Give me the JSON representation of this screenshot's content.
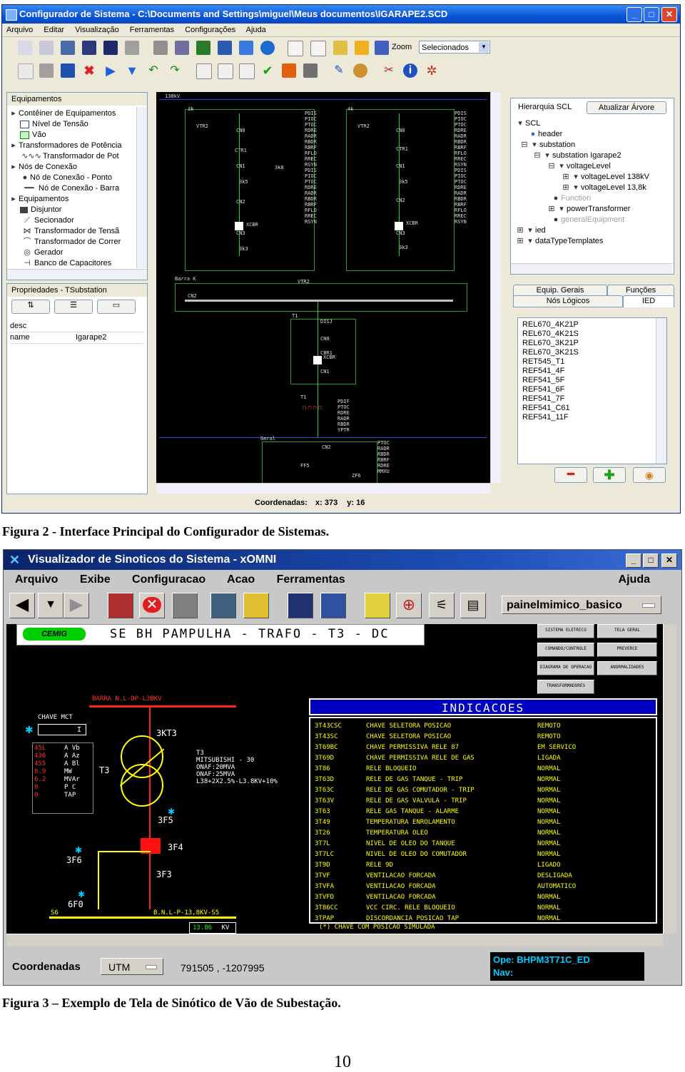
{
  "fig2": {
    "title": "Configurador de Sistema - C:\\Documents and Settings\\miguel\\Meus documentos\\IGARAPE2.SCD",
    "menu": [
      "Arquivo",
      "Editar",
      "Visualização",
      "Ferramentas",
      "Configurações",
      "Ajuda"
    ],
    "zoom_label": "Zoom",
    "zoom_select": "Selecionados",
    "equipamentos": {
      "header": "Equipamentos",
      "items": [
        "Contêiner de Equipamentos",
        "Nível de Tensão",
        "Vão",
        "Transformadores de Potência",
        "Transformador de Pot",
        "Nós de Conexão",
        "Nó de Conexão - Ponto",
        "Nó de Conexão - Barra",
        "Equipamentos",
        "Disjuntor",
        "Secionador",
        "Transformador de Tensã",
        "Transformador de Correr",
        "Gerador",
        "Banco de Capacitores"
      ]
    },
    "propriedades": {
      "header": "Propriedades - TSubstation",
      "rows": [
        {
          "key": "desc",
          "value": ""
        },
        {
          "key": "name",
          "value": "Igarape2"
        }
      ]
    },
    "diagram": {
      "bus_label": "138kV",
      "bay_left": {
        "label": "3k",
        "vt": "VTR2",
        "cb": "XCBR",
        "nodes": [
          "CN0",
          "CN1",
          "CN2",
          "CN3"
        ],
        "ctr": "CTR1",
        "sw": [
          "3k5",
          "3k8",
          "3k3",
          "3k4"
        ],
        "lns": "PDIS\nPIOC\nPTOC\nRDRE\nRADR\nRBDR\nRBRF\nRFLO\nRREC\nRSYN\nPDIS\nPIOC\nPTOC\nRDRE\nRADR\nRBDR\nRBRF\nRFLO\nRREC\nRSYN"
      },
      "bay_right": {
        "label": "4k",
        "vt": "VTR2",
        "cb": "XCBR",
        "nodes": [
          "CN0",
          "CN1",
          "CN2",
          "CN3"
        ],
        "ctr": "CTR1",
        "sw": [
          "3k5",
          "3k3"
        ],
        "lns": "PDIS\nPIOC\nPTOC\nRDRE\nRADR\nRBDR\nRBRF\nRFLO\nRREC\nRSYN\nPDIS\nPIOC\nPTOC\nRDRE\nRADR\nRBDR\nRBRF\nRFLO\nRREC\nRSYN"
      },
      "barra_label": "Barra K",
      "barra_cn": "CN2",
      "barra_vt": "VTR2",
      "t1_label": "T1",
      "t1_nodes": [
        "DISJ",
        "CN0",
        "CBR1",
        "XCBR",
        "CN1"
      ],
      "t1_lns": "PDIF\nPTOC\nRDRE\nRADR\nRBDR\nYPTR",
      "geral_label": "Geral",
      "geral_cn": "CN2",
      "geral_lns": "PTOC\nRADR\nRBDR\nRBRF\nRDRE\nMMXU",
      "geral_sw": [
        "FF5",
        "ZF6"
      ],
      "coords_label": "Coordenadas:",
      "coord_x": "x: 373",
      "coord_y": "y: 16"
    },
    "hierarquia": {
      "header": "Hierarquia SCL",
      "button": "Atualizar Árvore",
      "tree": [
        "SCL",
        "header",
        "substation",
        "substation Igarape2",
        "voltageLevel",
        "voltageLevel 138kV",
        "voltageLevel 13,8k",
        "Function",
        "powerTransformer",
        "generalEquipment",
        "ied",
        "dataTypeTemplates"
      ]
    },
    "tabs": [
      "Equip. Gerais",
      "Funções",
      "Nós Lógicos",
      "IED"
    ],
    "ied_list": [
      "REL670_4K21P",
      "REL670_4K21S",
      "REL670_3K21P",
      "REL670_3K21S",
      "RET545_T1",
      "REF541_4F",
      "REF541_5F",
      "REF541_6F",
      "REF541_7F",
      "REF541_C61",
      "REF541_11F"
    ]
  },
  "caption2": "Figura 2 - Interface Principal do Configurador de Sistemas.",
  "fig3": {
    "title": "Visualizador de Sinoticos do Sistema - xOMNI",
    "menu": [
      "Arquivo",
      "Exibe",
      "Configuracao",
      "Acao",
      "Ferramentas"
    ],
    "menu_help": "Ajuda",
    "painel_select": "painelmimico_basico",
    "logo": "CEMIG",
    "screen_title": "SE BH PAMPULHA - TRAFO - T3 - DC",
    "bus_label": "BARRA N.L-DP-L3BKV",
    "chave_label": "CHAVE MCT",
    "chave_value": "I",
    "meas_left": [
      "45L",
      "436",
      "455",
      "8.9",
      "6.2",
      "0",
      "0"
    ],
    "meas_right": [
      "A  Vb",
      "A  Az",
      "A  Bl",
      "MW",
      "MVAr",
      "P C",
      "TAP"
    ],
    "t3_label": "T3",
    "t3_info": "T3\nMITSUBISHI - 30\nONAF:20MVA\nONAF:25MVA\nL38+2X2.5%-L3.8KV+10%",
    "breaker_labels": [
      "3KT3",
      "3F5",
      "3F4",
      "3F3",
      "3F6",
      "6F0"
    ],
    "bus_bottom": "B.N.L-P-13,8KV-S5",
    "bus_bottom_left": "S6",
    "volt_value": "13.86",
    "volt_unit": "KV",
    "indicacoes_title": "INDICACOES",
    "indicacoes": [
      {
        "code": "3T43CSC",
        "desc": "CHAVE SELETORA POSICAO",
        "state": "REMOTO"
      },
      {
        "code": "3T43SC",
        "desc": "CHAVE SELETORA POSICAO",
        "state": "REMOTO"
      },
      {
        "code": "3T69BC",
        "desc": "CHAVE PERMISSIVA RELE 87",
        "state": "EM SERVICO"
      },
      {
        "code": "3T69D",
        "desc": "CHAVE PERMISSIVA RELE DE GAS",
        "state": "LIGADA"
      },
      {
        "code": "3T86",
        "desc": "RELE BLOQUEIO",
        "state": "NORMAL"
      },
      {
        "code": "3T63D",
        "desc": "RELE DE GAS TANQUE - TRIP",
        "state": "NORMAL"
      },
      {
        "code": "3T63C",
        "desc": "RELE DE GAS COMUTADOR - TRIP",
        "state": "NORMAL"
      },
      {
        "code": "3T63V",
        "desc": "RELE DE GAS VALVULA - TRIP",
        "state": "NORMAL"
      },
      {
        "code": "3T63",
        "desc": "RELE GAS TANQUE - ALARME",
        "state": "NORMAL"
      },
      {
        "code": "3T49",
        "desc": "TEMPERATURA ENROLAMENTO",
        "state": "NORMAL"
      },
      {
        "code": "3T26",
        "desc": "TEMPERATURA OLEO",
        "state": "NORMAL"
      },
      {
        "code": "3T7L",
        "desc": "NIVEL DE OLEO DO TANQUE",
        "state": "NORMAL"
      },
      {
        "code": "3T7LC",
        "desc": "NIVEL DE OLEO DO COMUTADOR",
        "state": "NORMAL"
      },
      {
        "code": "3T9D",
        "desc": "RELE 9D",
        "state": "LIGADO"
      },
      {
        "code": "3TVF",
        "desc": "VENTILACAO FORCADA",
        "state": "DESLIGADA"
      },
      {
        "code": "3TVFA",
        "desc": "VENTILACAO FORCADA",
        "state": "AUTOMATICO"
      },
      {
        "code": "3TVFD",
        "desc": "VENTILACAO FORCADA",
        "state": "NORMAL"
      },
      {
        "code": "3T86CC",
        "desc": "VCC CIRC. RELE BLOQUEIO",
        "state": "NORMAL"
      },
      {
        "code": "3TPAP",
        "desc": "DISCORDANCIA POSICAO TAP",
        "state": "NORMAL"
      }
    ],
    "footnote": "(*) CHAVE COM POSICAO SIMULADA",
    "nav_buttons": [
      "SISTEMA ELETRICO",
      "TELA GERAL",
      "COMANDO/CONTROLE",
      "PREVERCE",
      "DIAGRAMA DE OPERACAO",
      "ANORMALIDADES",
      "TRANSFORMADORES"
    ],
    "coords_label": "Coordenadas",
    "coord_system": "UTM",
    "coord_value": "791505 , -1207995",
    "status_ope": "Ope: BHPM3T71C_ED",
    "status_nav": "Nav:"
  },
  "caption3": "Figura 3 – Exemplo de Tela de Sinótico de Vão de Subestação.",
  "page_number": "10",
  "colors": {
    "green": "#00d000",
    "yellow": "#ffff00",
    "red": "#ff2020",
    "blue_header": "#0000c0",
    "cyan": "#00ccff"
  }
}
